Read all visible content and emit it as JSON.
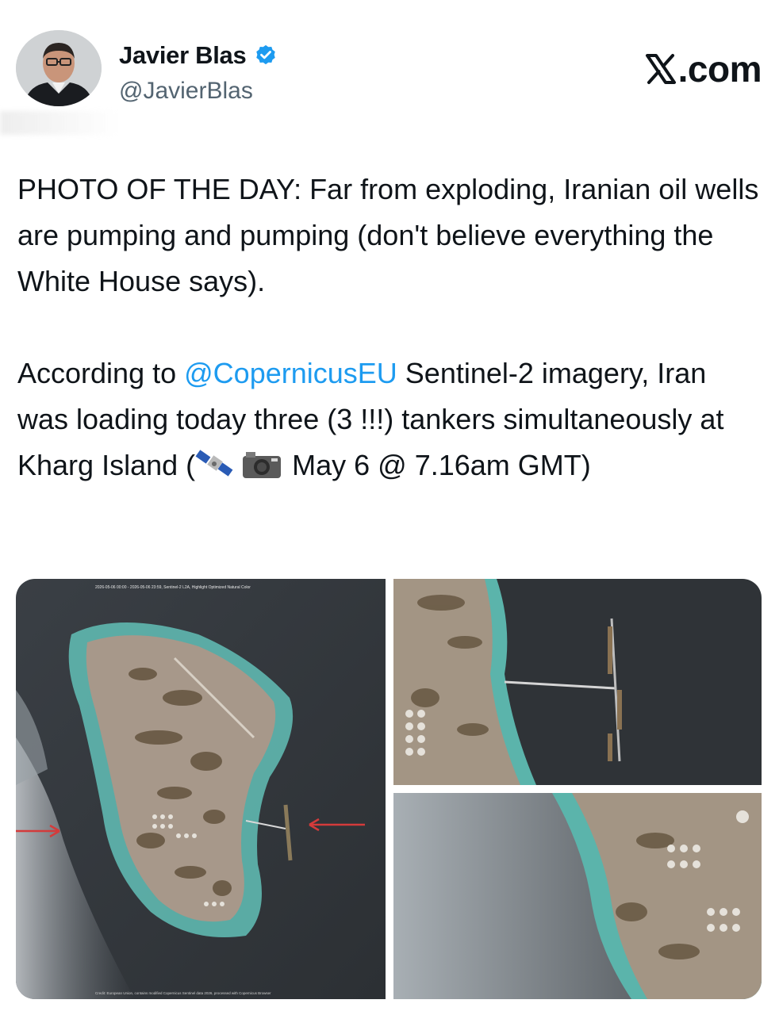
{
  "author": {
    "name": "Javier Blas",
    "handle": "@JavierBlas",
    "verified": true,
    "avatar_icon": "person-avatar-icon"
  },
  "brand": {
    "label": ".com",
    "logo_icon": "x-logo-icon"
  },
  "tweet": {
    "paragraph1": "PHOTO OF THE DAY: Far from exploding, Iranian oil wells are pumping and pumping (don't believe everything the White House says).",
    "paragraph2_before": "According to ",
    "mention": "@CopernicusEU",
    "paragraph2_after": " Sentinel-2 imagery, Iran was loading today three (3 !!!) tankers simultaneously at Kharg Island (",
    "paragraph2_end": " May 6 @ 7.16am GMT)",
    "emojis": [
      "satellite-icon",
      "camera-icon"
    ]
  },
  "media": {
    "main_caption": "2026-05-06 00:00 - 2026-05-06 23:59, Sentinel-2 L2A, Highlight Optimized Natural Color",
    "main_credit": "Credit: European Union, contains modified Copernicus Sentinel data 2026, processed with Copernicus Browser"
  },
  "colors": {
    "mention": "#1d9bf0",
    "verified": "#1d9bf0",
    "text": "#0f1419",
    "handle": "#536471"
  }
}
